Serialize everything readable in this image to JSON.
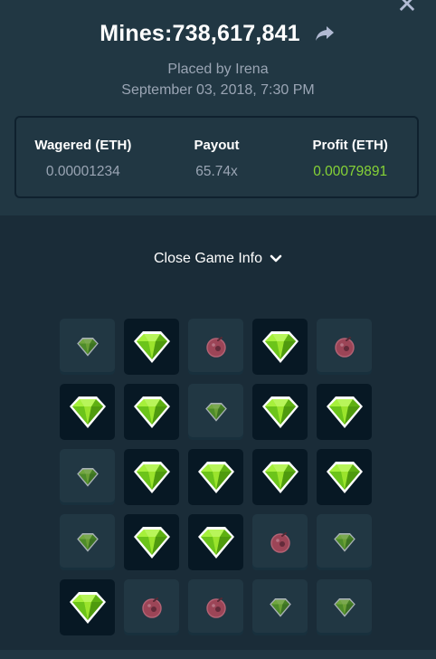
{
  "header": {
    "close_glyph": "✕",
    "title": "Mines:738,617,841",
    "share_icon": "share-arrow-icon",
    "placed_by": "Placed by Irena",
    "date": "September 03, 2018, 7:30 PM"
  },
  "stats": [
    {
      "label": "Wagered (ETH)",
      "value": "0.00001234"
    },
    {
      "label": "Payout",
      "value": "65.74x"
    },
    {
      "label": "Profit (ETH)",
      "value": "0.00079891"
    }
  ],
  "colors": {
    "profit": "#86d336",
    "gem": "#7fd61a",
    "mine": "#c64a5e",
    "panel": "#213743",
    "background": "#1a2c38"
  },
  "toggle": {
    "label": "Close Game Info",
    "icon": "chevron-down-icon"
  },
  "board": {
    "columns": 5,
    "rows": 5,
    "legend": {
      "g": "gem (revealed)",
      "d": "gem (not picked)",
      "m": "mine"
    },
    "tiles": [
      "d",
      "g",
      "m",
      "g",
      "m",
      "g",
      "g",
      "d",
      "g",
      "g",
      "d",
      "g",
      "g",
      "g",
      "g",
      "d",
      "g",
      "g",
      "m",
      "d",
      "g",
      "m",
      "m",
      "d",
      "d"
    ]
  }
}
